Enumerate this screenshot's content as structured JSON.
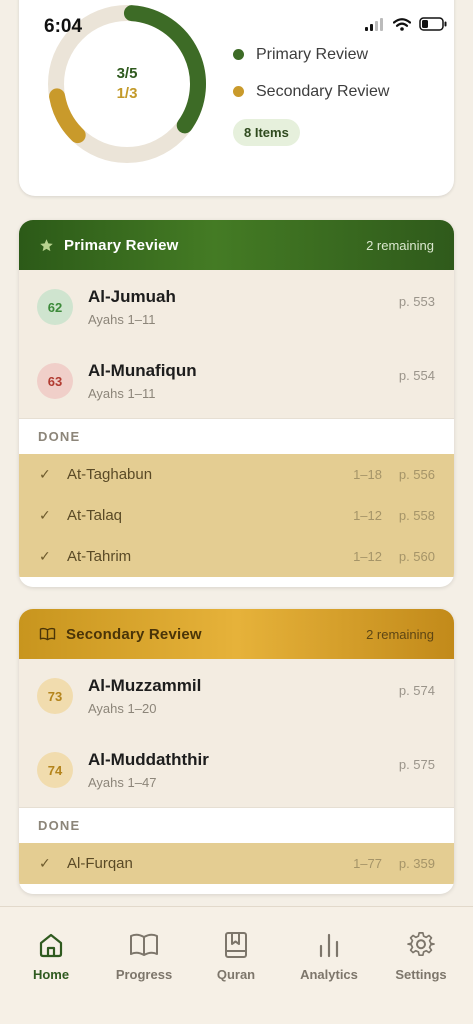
{
  "status": {
    "time": "6:04"
  },
  "summary": {
    "primary_count": "3/5",
    "secondary_count": "1/3",
    "primary_fraction": 0.6,
    "secondary_fraction": 0.333,
    "legend_primary": "Primary Review",
    "legend_secondary": "Secondary Review",
    "items_pill": "8 Items",
    "colors": {
      "primary": "#3d6b26",
      "secondary": "#c99a2b",
      "track": "#ebe4d8"
    }
  },
  "primary": {
    "title": "Primary Review",
    "remaining": "2 remaining",
    "icon": "star-icon",
    "surahs": [
      {
        "number": "62",
        "name": "Al-Jumuah",
        "ayahs": "Ayahs 1–11",
        "page": "p. 553"
      },
      {
        "number": "63",
        "name": "Al-Munafiqun",
        "ayahs": "Ayahs 1–11",
        "page": "p. 554"
      }
    ],
    "done_label": "DONE",
    "done": [
      {
        "name": "At-Taghabun",
        "range": "1–18",
        "page": "p. 556"
      },
      {
        "name": "At-Talaq",
        "range": "1–12",
        "page": "p. 558"
      },
      {
        "name": "At-Tahrim",
        "range": "1–12",
        "page": "p. 560"
      }
    ]
  },
  "secondary": {
    "title": "Secondary Review",
    "remaining": "2 remaining",
    "icon": "book-open-icon",
    "surahs": [
      {
        "number": "73",
        "name": "Al-Muzzammil",
        "ayahs": "Ayahs 1–20",
        "page": "p. 574"
      },
      {
        "number": "74",
        "name": "Al-Muddaththir",
        "ayahs": "Ayahs 1–47",
        "page": "p. 575"
      }
    ],
    "done_label": "DONE",
    "done": [
      {
        "name": "Al-Furqan",
        "range": "1–77",
        "page": "p. 359"
      }
    ]
  },
  "tabs": [
    {
      "label": "Home",
      "icon": "home-icon",
      "active": true
    },
    {
      "label": "Progress",
      "icon": "book-icon",
      "active": false
    },
    {
      "label": "Quran",
      "icon": "bookmark-book-icon",
      "active": false
    },
    {
      "label": "Analytics",
      "icon": "bar-chart-icon",
      "active": false
    },
    {
      "label": "Settings",
      "icon": "gear-icon",
      "active": false
    }
  ]
}
